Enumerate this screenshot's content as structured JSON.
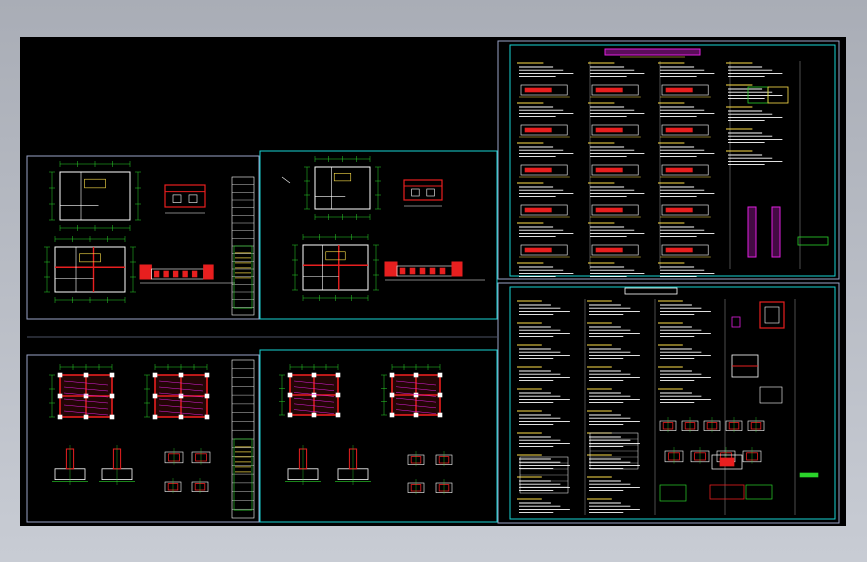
{
  "viewer": {
    "background_color": "#000000",
    "frame_color": "#b8bcc4"
  },
  "colors": {
    "sheet_border": "#9aa4c8",
    "active_border": "#19d3d3",
    "green": "#2bd42b",
    "red": "#e81f1f",
    "yellow": "#ffe14a",
    "magenta": "#e020e0",
    "white": "#ffffff",
    "cyan": "#19d3d3"
  },
  "sheets": [
    {
      "id": "sheet-a",
      "kind": "architectural-plan",
      "active": false
    },
    {
      "id": "sheet-b",
      "kind": "architectural-plan",
      "active": true
    },
    {
      "id": "sheet-c",
      "kind": "structural-plan",
      "active": false
    },
    {
      "id": "sheet-d",
      "kind": "structural-plan",
      "active": true
    },
    {
      "id": "sheet-e",
      "kind": "design-notes",
      "active": true
    },
    {
      "id": "sheet-f",
      "kind": "design-notes",
      "active": true
    }
  ]
}
